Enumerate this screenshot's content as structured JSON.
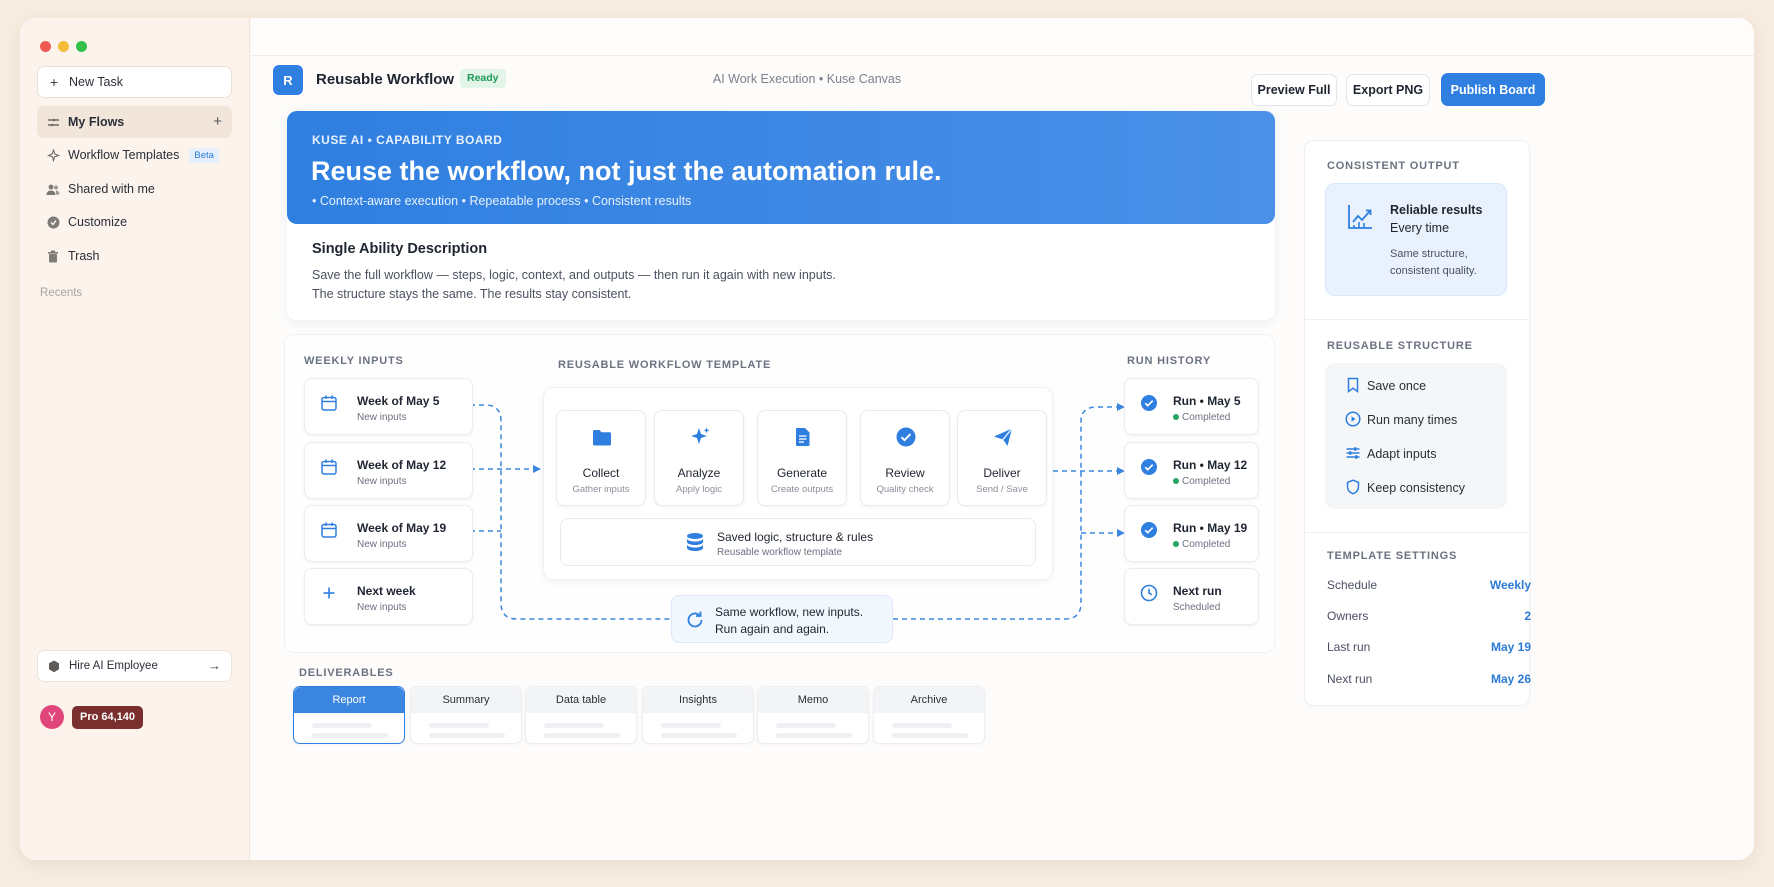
{
  "sidebar": {
    "new_task": "New Task",
    "items": [
      {
        "label": "My Flows"
      },
      {
        "label": "Workflow Templates",
        "badge": "Beta"
      },
      {
        "label": "Shared with me"
      },
      {
        "label": "Customize"
      },
      {
        "label": "Trash"
      }
    ],
    "recents_label": "Recents",
    "hire_label": "Hire AI Employee",
    "avatar_letter": "Y",
    "plan_label": "Pro 64,140"
  },
  "header": {
    "logo_letter": "R",
    "title": "Reusable Workflow",
    "status": "Ready",
    "breadcrumb": "AI Work Execution • Kuse Canvas",
    "preview_label": "Preview Full",
    "export_label": "Export PNG",
    "publish_label": "Publish Board"
  },
  "hero": {
    "eyebrow": "KUSE AI • CAPABILITY BOARD",
    "headline": "Reuse the workflow, not just the automation rule.",
    "bullets": "• Context-aware execution • Repeatable process • Consistent results"
  },
  "description": {
    "title": "Single Ability Description",
    "line1": "Save the full workflow — steps, logic, context, and outputs — then run it again with new inputs.",
    "line2": "The structure stays the same. The results stay consistent."
  },
  "flow": {
    "inputs_label": "WEEKLY INPUTS",
    "inputs": [
      {
        "title": "Week of May 5",
        "sub": "New inputs"
      },
      {
        "title": "Week of May 12",
        "sub": "New inputs"
      },
      {
        "title": "Week of May 19",
        "sub": "New inputs"
      },
      {
        "title": "Next week",
        "sub": "New inputs"
      }
    ],
    "template_label": "REUSABLE WORKFLOW TEMPLATE",
    "steps": [
      {
        "title": "Collect",
        "sub": "Gather inputs"
      },
      {
        "title": "Analyze",
        "sub": "Apply logic"
      },
      {
        "title": "Generate",
        "sub": "Create outputs"
      },
      {
        "title": "Review",
        "sub": "Quality check"
      },
      {
        "title": "Deliver",
        "sub": "Send / Save"
      }
    ],
    "saved_title": "Saved logic, structure & rules",
    "saved_sub": "Reusable workflow template",
    "loop_line1": "Same workflow, new inputs.",
    "loop_line2": "Run again and again.",
    "history_label": "RUN HISTORY",
    "runs": [
      {
        "title": "Run • May 5",
        "sub": "Completed"
      },
      {
        "title": "Run • May 12",
        "sub": "Completed"
      },
      {
        "title": "Run • May 19",
        "sub": "Completed"
      },
      {
        "title": "Next run",
        "sub": "Scheduled"
      }
    ]
  },
  "deliverables": {
    "label": "DELIVERABLES",
    "tabs": [
      "Report",
      "Summary",
      "Data table",
      "Insights",
      "Memo",
      "Archive"
    ]
  },
  "right_panel": {
    "consistent_label": "CONSISTENT OUTPUT",
    "reliable_title": "Reliable results",
    "reliable_sub": "Every time",
    "reliable_desc1": "Same structure,",
    "reliable_desc2": "consistent quality.",
    "reusable_label": "REUSABLE STRUCTURE",
    "reusable_items": [
      "Save once",
      "Run many times",
      "Adapt inputs",
      "Keep consistency"
    ],
    "settings_label": "TEMPLATE SETTINGS",
    "settings": [
      {
        "key": "Schedule",
        "value": "Weekly"
      },
      {
        "key": "Owners",
        "value": "2"
      },
      {
        "key": "Last run",
        "value": "May 19"
      },
      {
        "key": "Next run",
        "value": "May 26"
      }
    ]
  },
  "colors": {
    "accent": "#2f7fe0",
    "ready": "#1f9a55",
    "plan": "#7a2e2e",
    "avatar": "#e0467c"
  }
}
